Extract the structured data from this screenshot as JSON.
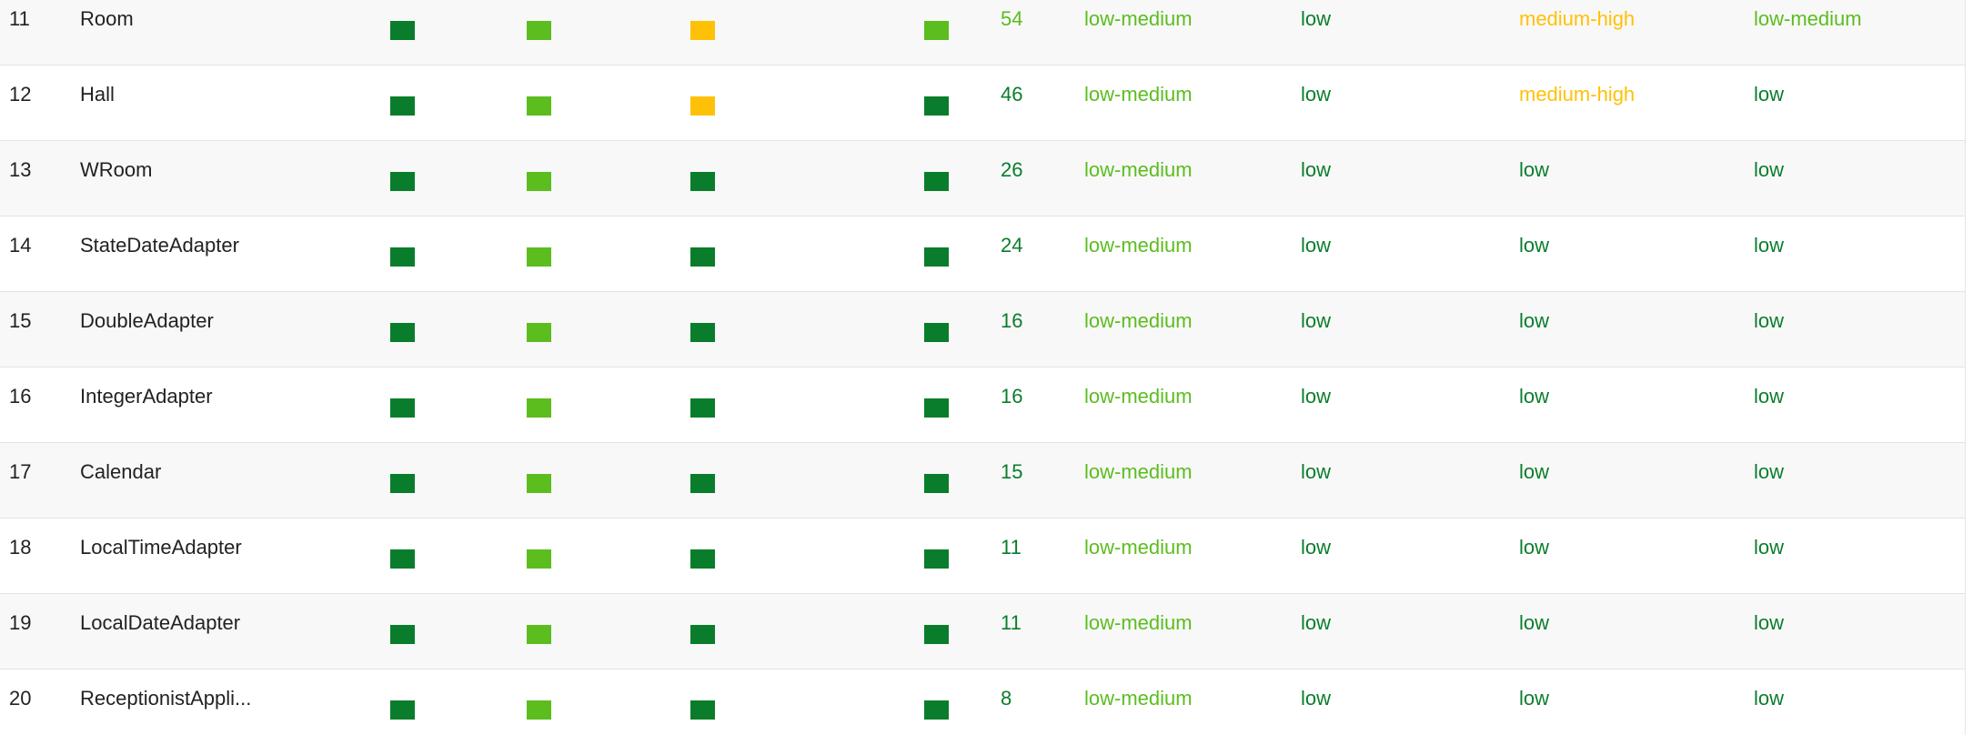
{
  "colors": {
    "low": "#0a7d2c",
    "low-medium": "#5bbd1e",
    "medium-high": "#ffc107"
  },
  "rows": [
    {
      "index": "11",
      "name": "Room",
      "squares": [
        "low",
        "low-medium",
        "medium-high",
        "low-medium"
      ],
      "value": "54",
      "value_level": "low-medium",
      "metrics": [
        "low-medium",
        "low",
        "medium-high",
        "low-medium"
      ]
    },
    {
      "index": "12",
      "name": "Hall",
      "squares": [
        "low",
        "low-medium",
        "medium-high",
        "low"
      ],
      "value": "46",
      "value_level": "low",
      "metrics": [
        "low-medium",
        "low",
        "medium-high",
        "low"
      ]
    },
    {
      "index": "13",
      "name": "WRoom",
      "squares": [
        "low",
        "low-medium",
        "low",
        "low"
      ],
      "value": "26",
      "value_level": "low",
      "metrics": [
        "low-medium",
        "low",
        "low",
        "low"
      ]
    },
    {
      "index": "14",
      "name": "StateDateAdapter",
      "squares": [
        "low",
        "low-medium",
        "low",
        "low"
      ],
      "value": "24",
      "value_level": "low",
      "metrics": [
        "low-medium",
        "low",
        "low",
        "low"
      ]
    },
    {
      "index": "15",
      "name": "DoubleAdapter",
      "squares": [
        "low",
        "low-medium",
        "low",
        "low"
      ],
      "value": "16",
      "value_level": "low",
      "metrics": [
        "low-medium",
        "low",
        "low",
        "low"
      ]
    },
    {
      "index": "16",
      "name": "IntegerAdapter",
      "squares": [
        "low",
        "low-medium",
        "low",
        "low"
      ],
      "value": "16",
      "value_level": "low",
      "metrics": [
        "low-medium",
        "low",
        "low",
        "low"
      ]
    },
    {
      "index": "17",
      "name": "Calendar",
      "squares": [
        "low",
        "low-medium",
        "low",
        "low"
      ],
      "value": "15",
      "value_level": "low",
      "metrics": [
        "low-medium",
        "low",
        "low",
        "low"
      ]
    },
    {
      "index": "18",
      "name": "LocalTimeAdapter",
      "squares": [
        "low",
        "low-medium",
        "low",
        "low"
      ],
      "value": "11",
      "value_level": "low",
      "metrics": [
        "low-medium",
        "low",
        "low",
        "low"
      ]
    },
    {
      "index": "19",
      "name": "LocalDateAdapter",
      "squares": [
        "low",
        "low-medium",
        "low",
        "low"
      ],
      "value": "11",
      "value_level": "low",
      "metrics": [
        "low-medium",
        "low",
        "low",
        "low"
      ]
    },
    {
      "index": "20",
      "name": "ReceptionistAppli...",
      "squares": [
        "low",
        "low-medium",
        "low",
        "low"
      ],
      "value": "8",
      "value_level": "low",
      "metrics": [
        "low-medium",
        "low",
        "low",
        "low"
      ]
    }
  ]
}
